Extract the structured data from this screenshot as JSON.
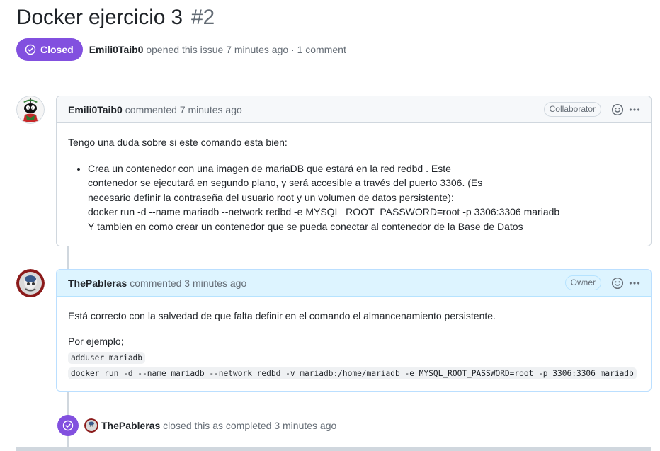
{
  "issue": {
    "title": "Docker ejercicio 3",
    "number": "#2",
    "state": "Closed",
    "author": "Emili0Taib0",
    "meta": "opened this issue 7 minutes ago · 1 comment"
  },
  "comments": [
    {
      "author": "Emili0Taib0",
      "action": "commented 7 minutes ago",
      "role": "Collaborator",
      "intro": "Tengo una duda sobre si este comando esta bien:",
      "bullet_lines": [
        "Crea un contenedor con una imagen de mariaDB que estará en la red redbd . Este",
        "contenedor se ejecutará en segundo plano, y será accesible a través del puerto 3306. (Es",
        "necesario definir la contraseña del usuario root y un volumen de datos persistente):",
        "docker run -d --name mariadb --network redbd -e MYSQL_ROOT_PASSWORD=root -p 3306:3306 mariadb",
        "Y tambien en como crear un contenedor que se pueda conectar al contenedor de la Base de Datos"
      ]
    },
    {
      "author": "ThePableras",
      "action": "commented 3 minutes ago",
      "role": "Owner",
      "text": "Está correcto con la salvedad de que falta definir en el comando el almancenamiento persistente.",
      "example_label": "Por ejemplo;",
      "code_lines": [
        "adduser mariadb",
        "docker run -d --name mariadb --network redbd -v mariadb:/home/mariadb -e MYSQL_ROOT_PASSWORD=root -p 3306:3306 mariadb"
      ]
    }
  ],
  "event": {
    "actor": "ThePableras",
    "text": "closed this as completed 3 minutes ago"
  },
  "colors": {
    "closed_purple": "#8250df",
    "owner_header_bg": "#ddf4ff",
    "header_bg": "#f6f8fa",
    "border": "#d0d7de",
    "muted_text": "#656d76"
  },
  "icons": {
    "state": "issue-closed-icon",
    "reaction": "smiley-icon",
    "menu": "kebab-horizontal-icon"
  }
}
